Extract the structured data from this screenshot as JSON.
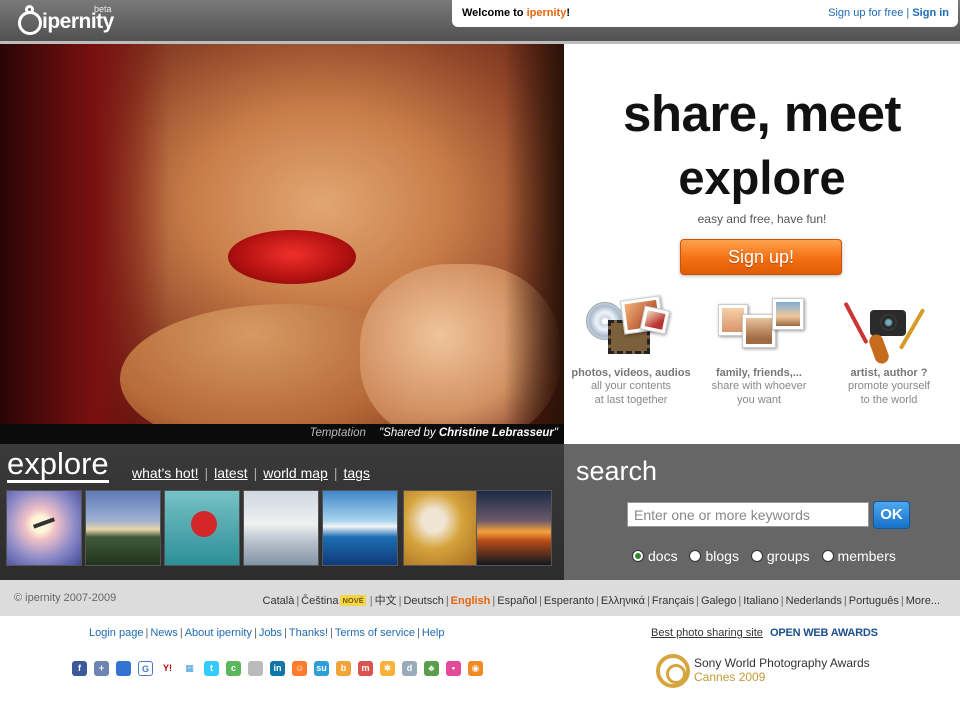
{
  "header": {
    "logo_text": "ipernity",
    "logo_badge": "beta",
    "welcome_prefix": "Welcome to ",
    "welcome_brand": "ipernity",
    "welcome_suffix": "!",
    "signup_free": "Sign up for free",
    "separator": "|",
    "signin": "Sign in"
  },
  "hero": {
    "caption_title": "Temptation",
    "caption_shared": "\"Shared by ",
    "caption_author": "Christine Lebrasseur",
    "caption_end": "\""
  },
  "tagline": {
    "headline_1": "share, meet",
    "headline_2": "explore",
    "subline": "easy and free, have fun!",
    "signup_button": "Sign up!",
    "features": [
      {
        "title": "photos, videos, audios",
        "line1": "all your contents",
        "line2": "at last together"
      },
      {
        "title": "family, friends,...",
        "line1": "share with whoever",
        "line2": "you want"
      },
      {
        "title": "artist, author ?",
        "line1": "promote yourself",
        "line2": "to the world"
      }
    ]
  },
  "explore": {
    "title": "explore",
    "links": [
      "what's hot!",
      "latest",
      "world map",
      "tags"
    ],
    "separator": "|"
  },
  "search": {
    "title": "search",
    "placeholder": "Enter one or more keywords",
    "ok_label": "OK",
    "options": [
      {
        "label": "docs",
        "selected": true
      },
      {
        "label": "blogs",
        "selected": false
      },
      {
        "label": "groups",
        "selected": false
      },
      {
        "label": "members",
        "selected": false
      }
    ]
  },
  "footer": {
    "copyright": "© ipernity 2007-2009",
    "languages": [
      "Català",
      "Čeština",
      "中文",
      "Deutsch",
      "English",
      "Español",
      "Esperanto",
      "Ελληνικά",
      "Français",
      "Galego",
      "Italiano",
      "Nederlands",
      "Português",
      "More..."
    ],
    "new_badge": "NOVÉ",
    "current_language": "English"
  },
  "bottom": {
    "links": [
      "Login page",
      "News",
      "About ipernity",
      "Jobs",
      "Thanks!",
      "Terms of service",
      "Help"
    ],
    "award_text": "Best photo sharing site",
    "award_brand": "OPEN WEB AWARDS",
    "sony_title": "Sony World Photography Awards",
    "sony_sub": "Cannes 2009"
  },
  "colors": {
    "accent_orange": "#e8640b",
    "link_blue": "#1e6ab4",
    "ok_blue": "#1572c8"
  }
}
